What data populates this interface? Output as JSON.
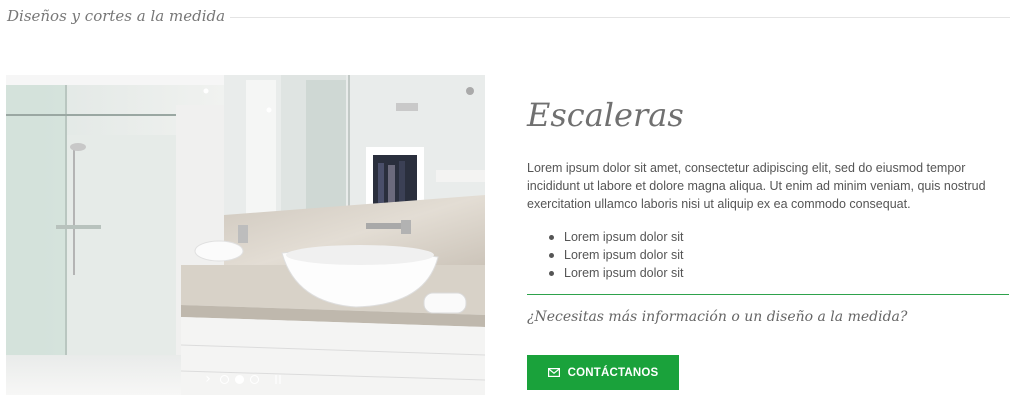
{
  "section": {
    "title": "Diseños y cortes a la medida"
  },
  "slider": {
    "image": "bathroom-vanity-photo",
    "slides": 3,
    "active_slide": 2,
    "next_icon": "chevron-right-icon",
    "pause_icon": "pause-icon"
  },
  "content": {
    "title": "Escaleras",
    "description": "Lorem ipsum dolor sit amet, consectetur adipiscing elit, sed do eiusmod tempor incididunt ut labore et dolore magna aliqua. Ut enim ad minim veniam, quis nostrud exercitation ullamco laboris nisi ut aliquip ex ea commodo consequat.",
    "bullets": [
      "Lorem ipsum dolor sit",
      "Lorem ipsum dolor sit",
      "Lorem ipsum dolor sit"
    ],
    "question": "¿Necesitas más información o un diseño a la medida?",
    "cta_label": "CONTÁCTANOS",
    "cta_icon": "envelope-icon"
  },
  "colors": {
    "accent_green": "#1aa23b",
    "divider_green": "#2ea24c",
    "title_gray": "#707070"
  }
}
